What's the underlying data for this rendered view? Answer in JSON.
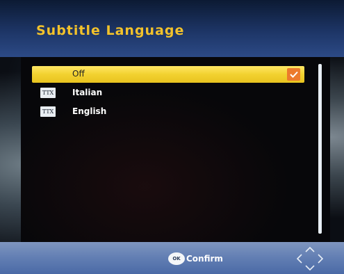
{
  "header": {
    "title": "Subtitle Language"
  },
  "list": {
    "items": [
      {
        "badge": "",
        "label": "Off",
        "selected": true,
        "checked": true
      },
      {
        "badge": "TTX",
        "label": "Italian",
        "selected": false
      },
      {
        "badge": "TTX",
        "label": "English",
        "selected": false
      }
    ]
  },
  "footer": {
    "ok_badge": "OK",
    "confirm_label": "Confirm",
    "nav_icon": "dpad-arrows-icon"
  },
  "colors": {
    "title": "#f2c22b",
    "highlight": "#f2d130",
    "check": "#ec7a2c",
    "header": "#1d3566",
    "footer": "#6480b4"
  }
}
